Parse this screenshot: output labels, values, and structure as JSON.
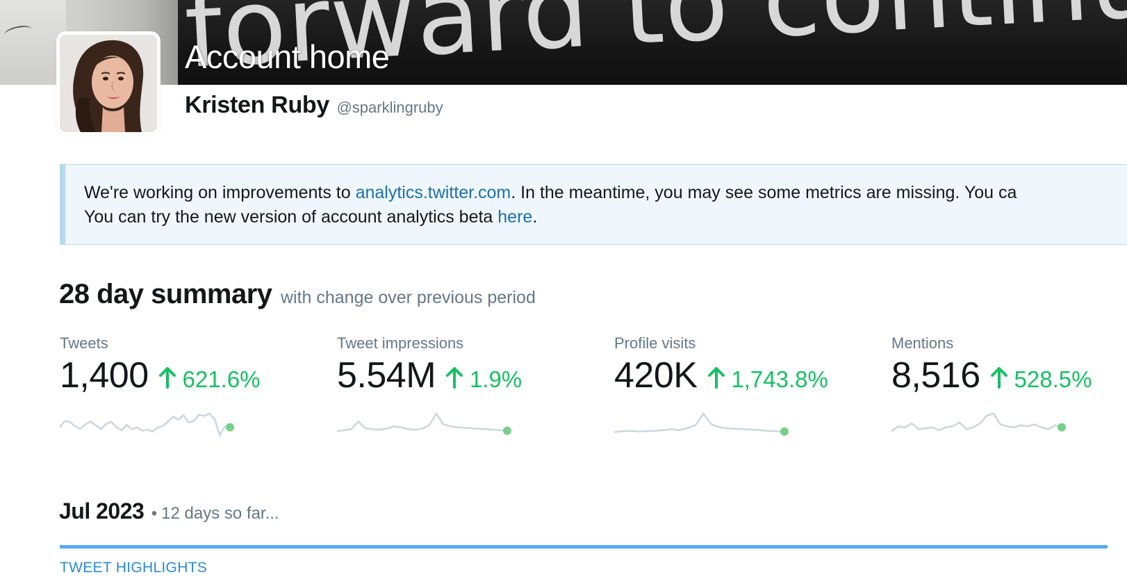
{
  "header": {
    "title": "Account home",
    "banner_text": "forward to continuing",
    "user_name": "Kristen Ruby",
    "user_handle": "@sparklingruby"
  },
  "notice": {
    "line1_start": "We're working on improvements to ",
    "line1_link": "analytics.twitter.com",
    "line1_end": ". In the meantime, you may see some metrics are missing. You ca",
    "line2_start": "You can try the new version of account analytics beta ",
    "line2_link": "here",
    "line2_end": "."
  },
  "summary": {
    "title": "28 day summary",
    "subtitle": "with change over previous period",
    "metrics": [
      {
        "label": "Tweets",
        "value": "1,400",
        "change": "621.6%",
        "trend": [
          0.3,
          0.62,
          0.58,
          0.35,
          0.22,
          0.45,
          0.6,
          0.4,
          0.2,
          0.48,
          0.58,
          0.3,
          0.15,
          0.42,
          0.2,
          0.3,
          0.12,
          0.18,
          0.08,
          0.3,
          0.35,
          0.6,
          0.85,
          0.7,
          0.92,
          0.55,
          0.62,
          0.95,
          0.88,
          1.0,
          0.75,
          -0.1,
          0.35,
          0.3
        ]
      },
      {
        "label": "Tweet impressions",
        "value": "5.54M",
        "change": "1.9%",
        "trend": [
          0.1,
          0.15,
          0.2,
          0.6,
          0.25,
          0.2,
          0.18,
          0.22,
          0.35,
          0.3,
          0.2,
          0.18,
          0.22,
          0.4,
          1.0,
          0.45,
          0.35,
          0.3,
          0.28,
          0.25,
          0.22,
          0.2,
          0.18,
          0.15,
          0.12
        ]
      },
      {
        "label": "Profile visits",
        "value": "420K",
        "change": "1,743.8%",
        "trend": [
          0.05,
          0.1,
          0.12,
          0.08,
          0.1,
          0.12,
          0.15,
          0.2,
          0.15,
          0.25,
          0.4,
          1.0,
          0.45,
          0.3,
          0.25,
          0.22,
          0.2,
          0.18,
          0.15,
          0.12,
          0.1,
          0.08
        ]
      },
      {
        "label": "Mentions",
        "value": "8,516",
        "change": "528.5%",
        "trend": [
          0.1,
          0.35,
          0.3,
          0.5,
          0.2,
          0.25,
          0.3,
          0.15,
          0.3,
          0.35,
          0.55,
          0.2,
          0.3,
          0.5,
          0.9,
          1.0,
          0.45,
          0.35,
          0.3,
          0.4,
          0.35,
          0.45,
          0.3,
          0.2,
          0.4,
          0.3
        ]
      }
    ]
  },
  "month": {
    "title": "Jul 2023",
    "separator": "•",
    "subtitle": "12 days so far..."
  },
  "tabs": {
    "highlights": "TWEET HIGHLIGHTS"
  },
  "colors": {
    "positive": "#17bf63",
    "link": "#1b6fae",
    "sparkline": "#ccd6dd",
    "sparkline_end": "#79cf88",
    "rule": "#55acee"
  }
}
